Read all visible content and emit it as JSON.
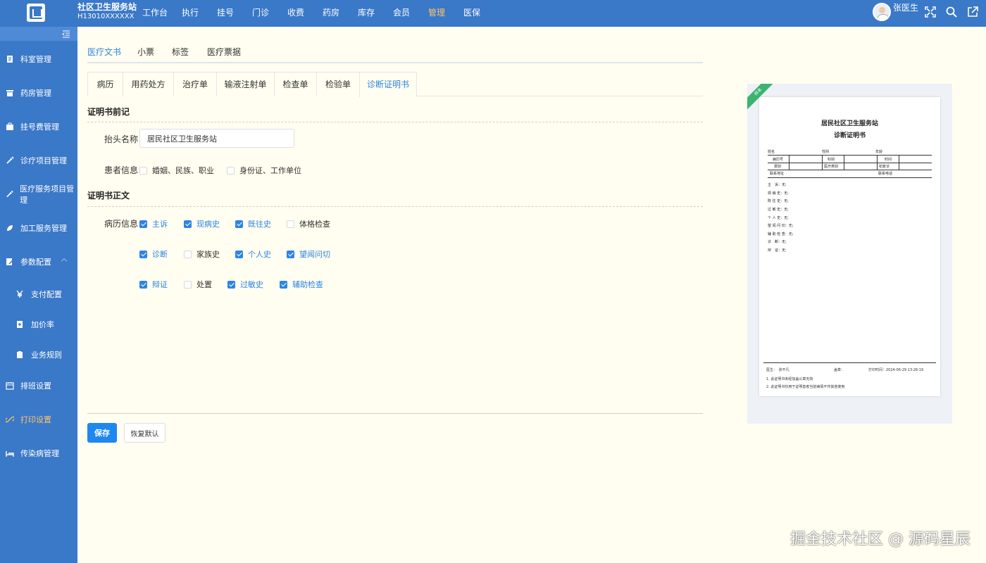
{
  "header": {
    "org_name": "社区卫生服务站",
    "org_code": "H13010XXXXXX",
    "nav": [
      "工作台",
      "执行",
      "挂号",
      "门诊",
      "收费",
      "药房",
      "库存",
      "会员",
      "管理",
      "医保"
    ],
    "active_nav": "管理",
    "user_name": "张医生"
  },
  "sidebar": {
    "items": [
      {
        "label": "科室管理"
      },
      {
        "label": "药房管理"
      },
      {
        "label": "挂号费管理"
      },
      {
        "label": "诊疗项目管理"
      },
      {
        "label": "医疗服务项目管理"
      },
      {
        "label": "加工服务管理"
      },
      {
        "label": "参数配置"
      },
      {
        "label": "支付配置"
      },
      {
        "label": "加价率"
      },
      {
        "label": "业务规则"
      },
      {
        "label": "排班设置"
      },
      {
        "label": "打印设置"
      },
      {
        "label": "传染病管理"
      }
    ]
  },
  "main_tabs": [
    "医疗文书",
    "小票",
    "标签",
    "医疗票据"
  ],
  "sub_tabs": [
    "病历",
    "用药处方",
    "治疗单",
    "输液注射单",
    "检查单",
    "检验单",
    "诊断证明书"
  ],
  "preface": {
    "title": "证明书前记",
    "header_label": "抬头名称",
    "header_value": "居民社区卫生服务站",
    "patient_label": "患者信息",
    "patient_options": [
      {
        "label": "婚姻、民族、职业",
        "checked": false
      },
      {
        "label": "身份证、工作单位",
        "checked": false
      }
    ]
  },
  "body": {
    "title": "证明书正文",
    "record_label": "病历信息",
    "row1": [
      {
        "label": "主诉",
        "checked": true
      },
      {
        "label": "现病史",
        "checked": true
      },
      {
        "label": "既往史",
        "checked": true
      },
      {
        "label": "体格检查",
        "checked": false
      }
    ],
    "row2": [
      {
        "label": "诊断",
        "checked": true
      },
      {
        "label": "家族史",
        "checked": false
      },
      {
        "label": "个人史",
        "checked": true
      },
      {
        "label": "望闻问切",
        "checked": true
      }
    ],
    "row3": [
      {
        "label": "辩证",
        "checked": true
      },
      {
        "label": "处置",
        "checked": false
      },
      {
        "label": "过敏史",
        "checked": true
      },
      {
        "label": "辅助检查",
        "checked": true
      }
    ]
  },
  "buttons": {
    "save": "保存",
    "reset": "恢复默认"
  },
  "preview": {
    "ribbon": "样本",
    "title1": "居民社区卫生服务站",
    "title2": "诊断证明书",
    "row_name": "姓名",
    "row_gender": "性别",
    "row_age": "年龄",
    "cell_record_no": "病历号",
    "cell_dept": "科别",
    "cell_time": "时间",
    "cell_fee": "费别",
    "cell_med_type": "医疗类别",
    "cell_visit": "初复诊",
    "cell_address": "联系地址",
    "cell_phone": "联系电话",
    "fields": [
      "主　诉：无;",
      "现 病 史：无;",
      "既 往 史：无;",
      "过 敏 史：无;",
      "个 人 史：无;",
      "望 闻 问 切：无;",
      "辅 助 检 查：无;",
      "诊　断：无;",
      "辩　证：无;"
    ],
    "doctor": "医生：　张不凡",
    "seal": "盖章：",
    "print_time": "打印时间：2024-06-29 13:26:19",
    "note1": "1. 此证明书未经加盖公章无效",
    "note2": "2. 此证明书仅用于证明患者当前病情不作其他使用"
  },
  "watermark": "掘金技术社区 @ 源码星辰",
  "colors": {
    "primary": "#3a78c8",
    "accent": "#2d84e3",
    "active_nav": "#ffc46b",
    "background": "#fffef0"
  }
}
